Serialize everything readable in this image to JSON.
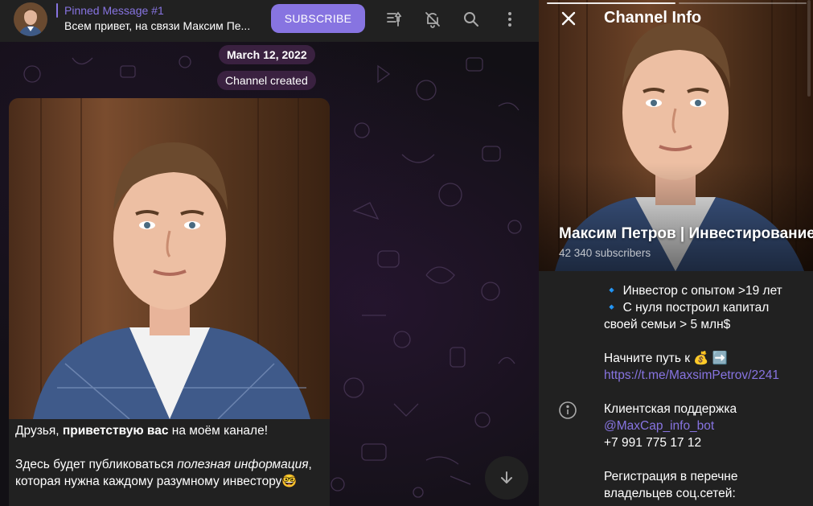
{
  "header": {
    "pinned_title": "Pinned Message #1",
    "pinned_text": "Всем привет, на связи Максим Пе...",
    "subscribe_label": "SUBSCRIBE"
  },
  "chat": {
    "date": "March 12, 2022",
    "service_message": "Channel created",
    "message": {
      "line1_pre": "Друзья, ",
      "line1_bold": "приветствую вас",
      "line1_post": " на моём канале!",
      "line2_pre": "Здесь будет публиковаться ",
      "line2_italic": "полезная информация",
      "line2_post": ", которая нужна каждому разумному инвестору🤓"
    }
  },
  "panel": {
    "title": "Channel Info",
    "channel_name": "Максим Петров | Инвестирование",
    "subscribers": "42 340 subscribers",
    "desc_line1": "🔹 Инвестор с опытом >19 лет",
    "desc_line2": "🔹 С нуля построил капитал",
    "desc_line3": "своей семьи > 5 млн$",
    "desc_line4": "Начните путь к 💰 ➡️",
    "desc_link": "https://t.me/MaxsimPetrov/2241",
    "support_label": "Клиентская поддержка",
    "support_bot": "@MaxCap_info_bot",
    "support_phone": "+7 991 775 17 12",
    "reg_line1": "Регистрация в перечне",
    "reg_line2": "владельцев соц.сетей:"
  },
  "colors": {
    "accent": "#8774e1",
    "panel_bg": "#212121",
    "pill_bg": "#3a2140"
  },
  "icons": [
    "pin-list-icon",
    "mute-bell-icon",
    "search-icon",
    "more-vertical-icon",
    "close-icon",
    "info-icon",
    "arrow-down-icon"
  ]
}
